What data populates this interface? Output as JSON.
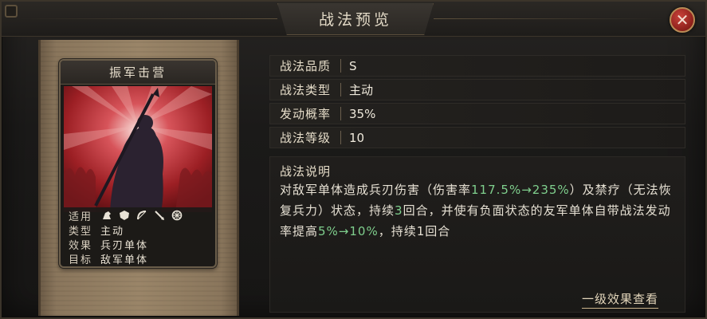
{
  "dialog": {
    "title": "战法预览",
    "close_icon": "close-icon"
  },
  "card": {
    "name": "振军击营",
    "props": {
      "applicable_label": "适用",
      "applicable_icons": [
        "cavalry-icon",
        "shield-icon",
        "bow-icon",
        "spear-icon",
        "siege-wheel-icon"
      ],
      "type_label": "类型",
      "type_value": "主动",
      "effect_label": "效果",
      "effect_value": "兵刃单体",
      "target_label": "目标",
      "target_value": "敌军单体"
    }
  },
  "info": {
    "quality_label": "战法品质",
    "quality_value": "S",
    "type_label": "战法类型",
    "type_value": "主动",
    "rate_label": "发动概率",
    "rate_value": "35%",
    "level_label": "战法等级",
    "level_value": "10"
  },
  "description": {
    "title": "战法说明",
    "seg1": "对敌军单体造成兵刃伤害（伤害率",
    "hl1": "117.5%→235%",
    "seg2": "）及禁疗（无法恢复兵力）状态，持续",
    "hl2": "3",
    "seg3": "回合，并使有负面状态的友军单体自带战法发动率提高",
    "hl3": "5%→10%",
    "seg4": "，持续1回合"
  },
  "links": {
    "level1_effects": "一级效果查看"
  },
  "colors": {
    "highlight": "#7fcf8d",
    "close_red": "#a52b23",
    "art_red": "#c0282a"
  }
}
